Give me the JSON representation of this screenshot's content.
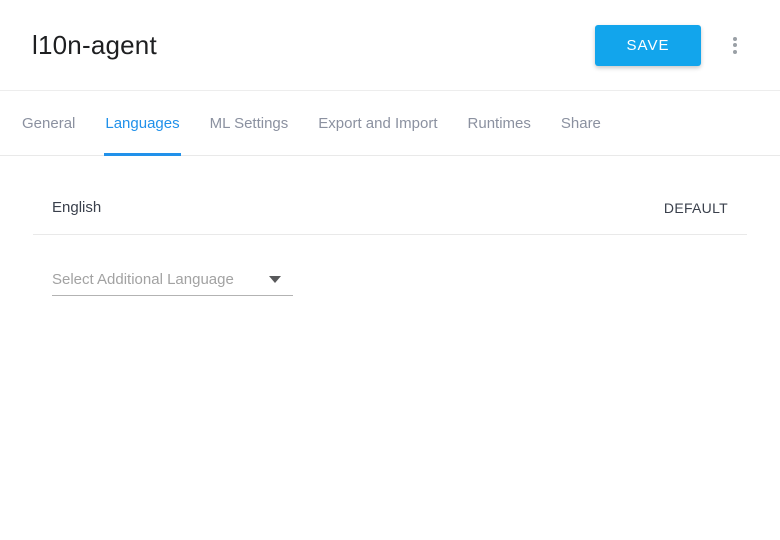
{
  "header": {
    "title": "l10n-agent",
    "save_button": "SAVE"
  },
  "tabs": [
    {
      "label": "General",
      "active": false
    },
    {
      "label": "Languages",
      "active": true
    },
    {
      "label": "ML Settings",
      "active": false
    },
    {
      "label": "Export and Import",
      "active": false
    },
    {
      "label": "Runtimes",
      "active": false
    },
    {
      "label": "Share",
      "active": false
    }
  ],
  "languages_panel": {
    "default_language": "English",
    "default_badge": "DEFAULT",
    "add_language_placeholder": "Select Additional Language"
  },
  "icons": {
    "header_menu": "kebab-menu-icon",
    "language_select": "caret-down-icon"
  },
  "colors": {
    "save_button_bg": "#12a5ec",
    "active_tab_blue": "#2191ea",
    "inactive_tab_gray": "#8b91a0",
    "dark_text": "#3a404c",
    "placeholder_gray": "#a2a2a2",
    "divider_light": "#e9e9e9",
    "select_underline": "#b3b3b3"
  }
}
